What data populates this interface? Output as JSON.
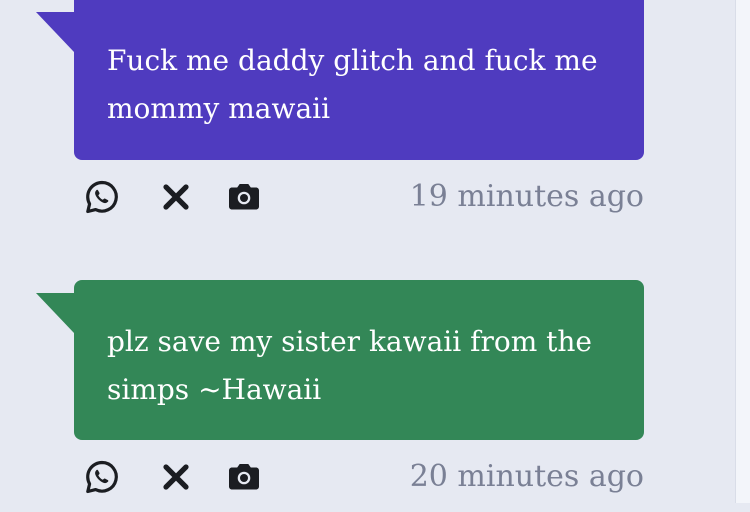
{
  "posts": [
    {
      "message": "Fuck me daddy glitch and fuck me mommy mawaii",
      "timestamp": "19 minutes ago",
      "bubble_color": "#4f3bbf"
    },
    {
      "message": "plz save my sister kawaii from the simps ~Hawaii",
      "timestamp": "20 minutes ago",
      "bubble_color": "#338757"
    }
  ],
  "actions": {
    "icons": [
      "whatsapp-icon",
      "close-icon",
      "camera-icon"
    ]
  },
  "colors": {
    "background": "#e6e9f2",
    "timestamp": "#7a8095",
    "icon": "#1b1d22"
  }
}
